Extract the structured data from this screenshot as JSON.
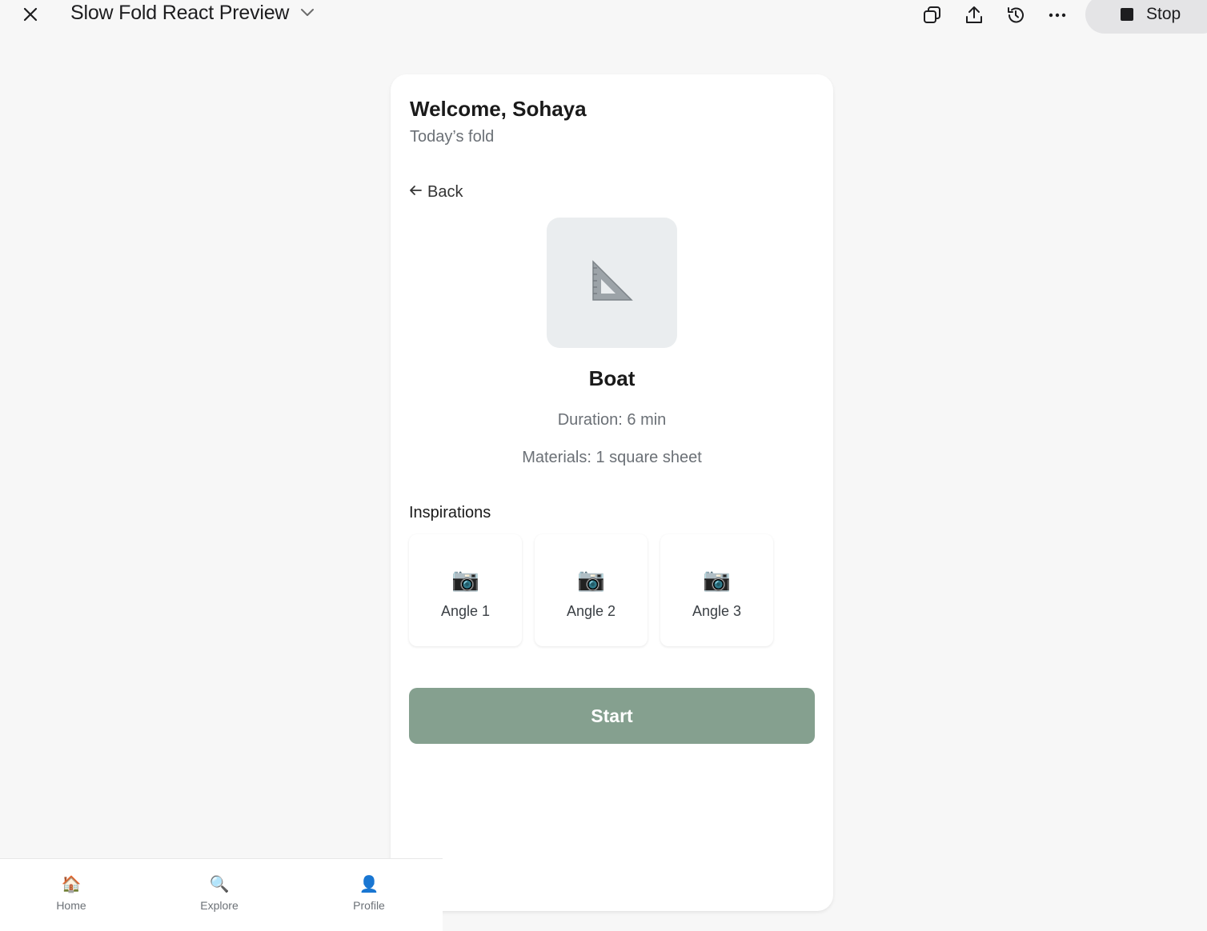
{
  "window": {
    "title": "Slow Fold React Preview",
    "stop_label": "Stop"
  },
  "icons": {
    "close": "close-icon",
    "dropdown": "chevron-down-icon",
    "copy": "copy-icon",
    "share": "share-icon",
    "history": "history-icon",
    "more": "more-icon",
    "stop": "stop-icon"
  },
  "header": {
    "welcome": "Welcome, Sohaya",
    "subtitle": "Today’s fold"
  },
  "back": {
    "label": "Back"
  },
  "fold": {
    "name": "Boat",
    "duration": "Duration: 6 min",
    "materials": "Materials: 1 square sheet",
    "image_icon": "📐"
  },
  "inspirations": {
    "title": "Inspirations",
    "items": [
      {
        "icon": "📷",
        "label": "Angle 1"
      },
      {
        "icon": "📷",
        "label": "Angle 2"
      },
      {
        "icon": "📷",
        "label": "Angle 3"
      }
    ]
  },
  "actions": {
    "start_label": "Start"
  },
  "nav": {
    "items": [
      {
        "icon": "🏠",
        "label": "Home"
      },
      {
        "icon": "🔍",
        "label": "Explore"
      },
      {
        "icon": "👤",
        "label": "Profile"
      }
    ]
  },
  "colors": {
    "accent": "#85a08f",
    "background": "#f7f7f7",
    "card": "#ffffff",
    "muted_text": "#6b7076"
  }
}
